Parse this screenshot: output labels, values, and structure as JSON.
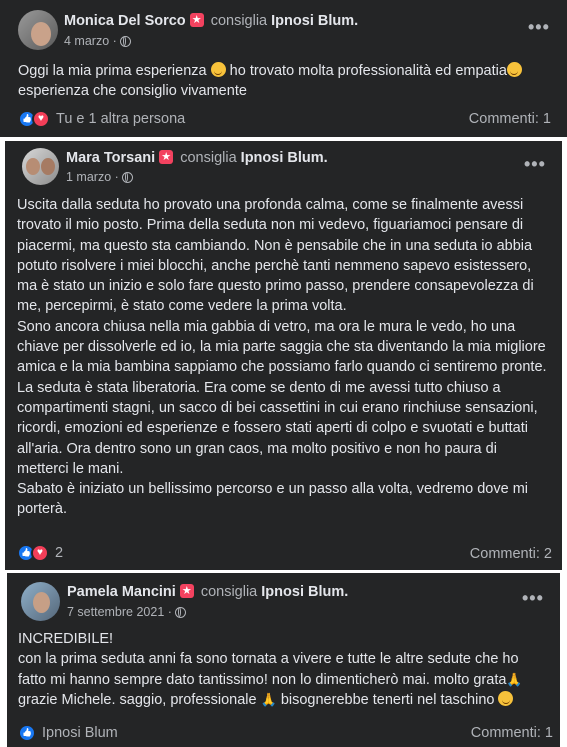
{
  "reviews": [
    {
      "author": "Monica Del Sorco",
      "verb": "consiglia",
      "page": "Ipnosi Blum.",
      "date": "4 marzo",
      "date_sep": "·",
      "text_lines": [
        "Oggi la mia prima esperienza",
        "ho trovato molta professionalità ed empatia",
        "esperienza che consiglio vivamente"
      ],
      "reactions_label": "Tu e 1 altra persona",
      "comments_label": "Commenti: 1",
      "more_label": "•••"
    },
    {
      "author": "Mara Torsani",
      "verb": "consiglia",
      "page": "Ipnosi Blum.",
      "date": "1 marzo",
      "date_sep": "·",
      "paragraphs": [
        "Uscita dalla seduta ho provato una profonda calma, come se finalmente avessi trovato il mio posto. Prima della seduta non mi vedevo, figuariamoci pensare di piacermi, ma questo sta cambiando. Non è pensabile che in una seduta io abbia potuto risolvere i miei blocchi, anche perchè tanti nemmeno sapevo esistessero, ma è stato un inizio e solo fare questo primo passo, prendere consapevolezza di me, percepirmi, è stato come vedere la prima volta.",
        "Sono ancora chiusa nella mia gabbia di vetro, ma ora le mura le vedo, ho una chiave per dissolverle ed io, la mia parte saggia che sta diventando la mia migliore amica e la mia bambina sappiamo che possiamo farlo quando ci sentiremo pronte.",
        "La seduta è stata liberatoria. Era come se dento di me avessi tutto chiuso a compartimenti stagni, un sacco di bei cassettini in cui erano rinchiuse sensazioni, ricordi, emozioni ed esperienze e fossero stati aperti di colpo e svuotati e buttati all'aria. Ora dentro sono un gran caos, ma molto positivo e non ho paura di metterci le mani.",
        "Sabato è iniziato un bellissimo percorso e un passo alla volta, vedremo dove mi porterà."
      ],
      "reactions_label": "2",
      "comments_label": "Commenti: 2",
      "more_label": "•••"
    },
    {
      "author": "Pamela Mancini",
      "verb": "consiglia",
      "page": "Ipnosi Blum.",
      "date": "7 settembre 2021",
      "date_sep": "·",
      "text_lines": [
        "INCREDIBILE!",
        "con la prima seduta anni fa sono tornata a vivere e tutte le altre sedute che ho fatto mi hanno sempre dato tantissimo! non lo dimenticherò mai. molto grata",
        "grazie Michele. saggio, professionale",
        "bisognerebbe tenerti nel taschino"
      ],
      "reactions_label": "Ipnosi Blum",
      "comments_label": "Commenti: 1",
      "more_label": "•••"
    }
  ],
  "colors": {
    "card_bg": "#242526",
    "text_primary": "#e4e6eb",
    "text_secondary": "#b0b3b8",
    "like_blue": "#1877f2",
    "love_red": "#f33e58",
    "recommend_badge": "#f3425f"
  },
  "icons": [
    "avatar",
    "recommend-badge-icon",
    "globe-icon",
    "more-options-icon",
    "like-reaction-icon",
    "love-reaction-icon",
    "smile-emoji",
    "folded-hands-emoji",
    "grin-emoji"
  ]
}
